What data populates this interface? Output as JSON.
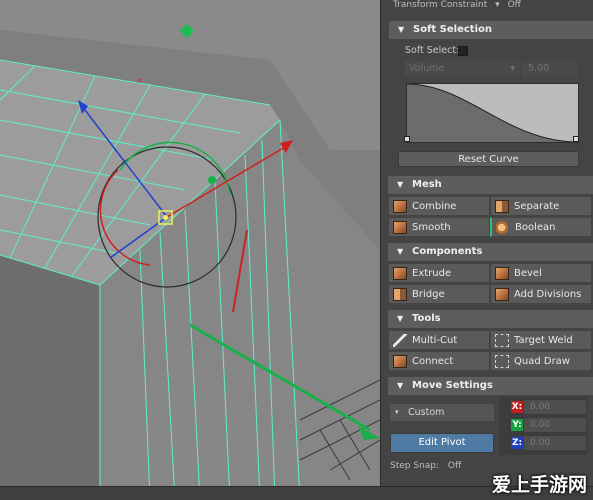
{
  "top_row": {
    "label": "Transform Constraint",
    "value": "Off"
  },
  "soft_selection": {
    "title": "Soft Selection",
    "soft_select_label": "Soft Select:",
    "falloff_mode": "Volume",
    "radius_value": "5.00",
    "reset_curve_label": "Reset Curve"
  },
  "mesh": {
    "title": "Mesh",
    "tools": [
      {
        "label": "Combine",
        "icon": "combine-icon"
      },
      {
        "label": "Separate",
        "icon": "separate-icon"
      },
      {
        "label": "Smooth",
        "icon": "smooth-icon"
      },
      {
        "label": "Boolean",
        "icon": "boolean-icon"
      }
    ]
  },
  "components": {
    "title": "Components",
    "tools": [
      {
        "label": "Extrude",
        "icon": "extrude-icon"
      },
      {
        "label": "Bevel",
        "icon": "bevel-icon"
      },
      {
        "label": "Bridge",
        "icon": "bridge-icon"
      },
      {
        "label": "Add Divisions",
        "icon": "add-divisions-icon"
      }
    ]
  },
  "tools": {
    "title": "Tools",
    "tools": [
      {
        "label": "Multi-Cut",
        "icon": "multi-cut-icon"
      },
      {
        "label": "Target Weld",
        "icon": "target-weld-icon"
      },
      {
        "label": "Connect",
        "icon": "connect-icon"
      },
      {
        "label": "Quad Draw",
        "icon": "quad-draw-icon"
      }
    ]
  },
  "move_settings": {
    "title": "Move Settings",
    "mode": "Custom",
    "edit_pivot_label": "Edit Pivot",
    "x_label": "X:",
    "x_value": "0.00",
    "y_label": "Y:",
    "y_value": "0.00",
    "z_label": "Z:",
    "z_value": "0.00",
    "step_snap_label": "Step Snap:",
    "step_snap_value": "Off"
  },
  "watermark": "爱上手游网",
  "colors": {
    "viewport_bg": "#7f7f7f",
    "wire": "#5cf0c8",
    "axis_x": "#d02020",
    "axis_y": "#18b048",
    "axis_z": "#2040d0",
    "edit_pivot": "#4f7aa3",
    "panel_bg": "#444444"
  }
}
